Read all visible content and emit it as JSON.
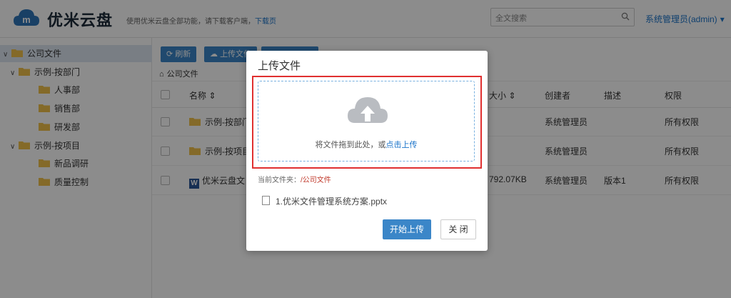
{
  "header": {
    "brand": "优米云盘",
    "notice_text": "使用优米云盘全部功能，请下载客户端，",
    "notice_link": "下载页",
    "search_placeholder": "全文搜索",
    "user": "系统管理员(admin)"
  },
  "sidebar": {
    "items": [
      {
        "label": "公司文件",
        "level": 0,
        "expanded": true,
        "selected": true
      },
      {
        "label": "示例-按部门",
        "level": 1,
        "expanded": true
      },
      {
        "label": "人事部",
        "level": 2
      },
      {
        "label": "销售部",
        "level": 2
      },
      {
        "label": "研发部",
        "level": 2
      },
      {
        "label": "示例-按项目",
        "level": 1,
        "expanded": true
      },
      {
        "label": "新品调研",
        "level": 2
      },
      {
        "label": "质量控制",
        "level": 2
      }
    ]
  },
  "toolbar": {
    "refresh": "刷新",
    "upload": "上传文件"
  },
  "breadcrumb": "公司文件",
  "table": {
    "headers": {
      "name": "名称 ⇕",
      "size": "大小 ⇕",
      "creator": "创建者",
      "desc": "描述",
      "perm": "权限"
    },
    "rows": [
      {
        "name": "示例-按部门",
        "size": "",
        "creator": "系统管理员",
        "desc": "",
        "perm": "所有权限"
      },
      {
        "name": "示例-按项目",
        "size": "",
        "creator": "系统管理员",
        "desc": "",
        "perm": "所有权限"
      },
      {
        "name": "优米云盘文",
        "size": "792.07KB",
        "creator": "系统管理员",
        "desc": "版本1",
        "perm": "所有权限"
      }
    ]
  },
  "modal": {
    "title": "上传文件",
    "drop_text": "将文件拖到此处，或",
    "drop_link": "点击上传",
    "folder_label": "当前文件夹：",
    "folder_path": "/公司文件",
    "file_name": "1.优米文件管理系统方案.pptx",
    "start_button": "开始上传",
    "close_button": "关 闭"
  },
  "colors": {
    "accent": "#3b86c8",
    "link": "#1a73c9",
    "highlight": "#e03030",
    "folder": "#f0c24b"
  }
}
